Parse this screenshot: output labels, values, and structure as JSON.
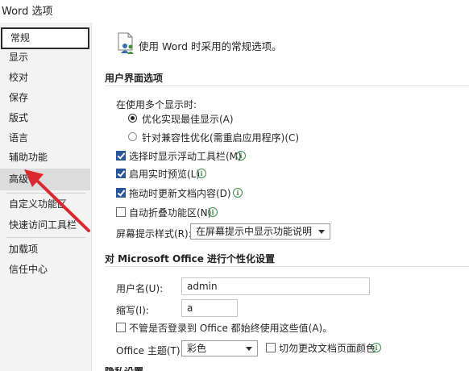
{
  "window": {
    "title": "Word 选项"
  },
  "sidebar": {
    "items": [
      {
        "label": "常规"
      },
      {
        "label": "显示"
      },
      {
        "label": "校对"
      },
      {
        "label": "保存"
      },
      {
        "label": "版式"
      },
      {
        "label": "语言"
      },
      {
        "label": "辅助功能"
      },
      {
        "label": "高级"
      },
      {
        "label": "自定义功能区"
      },
      {
        "label": "快速访问工具栏"
      },
      {
        "label": "加载项"
      },
      {
        "label": "信任中心"
      }
    ],
    "selected": "常规",
    "highlighted": "高级"
  },
  "main": {
    "header": {
      "icon": "options-people-icon",
      "text": "使用 Word 时采用的常规选项。"
    },
    "ui_options": {
      "title": "用户界面选项",
      "multi_display_label": "在使用多个显示时:",
      "radio_best": "优化实现最佳显示(A)",
      "radio_compat": "针对兼容性优化(需重启应用程序)(C)",
      "cb_mini_toolbar": "选择时显示浮动工具栏(M)",
      "cb_live_preview": "启用实时预览(L)",
      "cb_drag_update": "拖动时更新文档内容(D)",
      "cb_collapse_ribbon": "自动折叠功能区(N)",
      "screentip_label": "屏幕提示样式(R):",
      "screentip_value": "在屏幕提示中显示功能说明"
    },
    "personalize": {
      "title": "对 Microsoft Office 进行个性化设置",
      "username_label": "用户名(U):",
      "username_value": "admin",
      "initials_label": "缩写(I):",
      "initials_value": "a",
      "always_use_label": "不管是否登录到 Office 都始终使用这些值(A)。",
      "theme_label": "Office 主题(T):",
      "theme_value": "彩色",
      "never_change_label": "切勿更改文档页面颜色"
    },
    "next_section_partial": "隐私设置"
  },
  "colors": {
    "checkbox_checked": "#2b579a",
    "arrow": "#d9282f",
    "info_icon": "#3b8a4a"
  }
}
